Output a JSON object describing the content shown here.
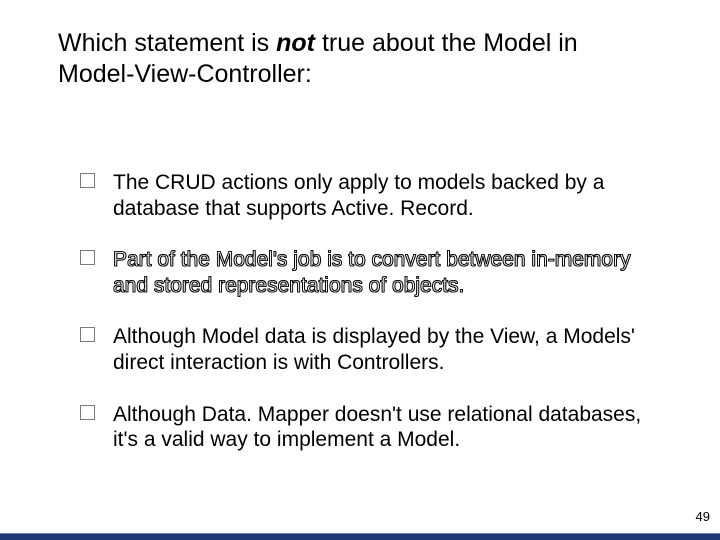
{
  "question": {
    "before_not": "Which statement is ",
    "not_word": "not",
    "after_not": " true about the Model in Model-View-Controller:"
  },
  "options": [
    {
      "text": "The CRUD actions only apply to models backed by a database that supports Active. Record.",
      "outlined": false
    },
    {
      "text": "Part of the Model's job is to convert between in-memory and stored representations of objects.",
      "outlined": true
    },
    {
      "text": "Although Model data is displayed by the View, a Models' direct interaction is with Controllers.",
      "outlined": false
    },
    {
      "text": "Although Data. Mapper doesn't use relational databases, it's a valid way to implement a Model.",
      "outlined": false
    }
  ],
  "page_number": "49"
}
